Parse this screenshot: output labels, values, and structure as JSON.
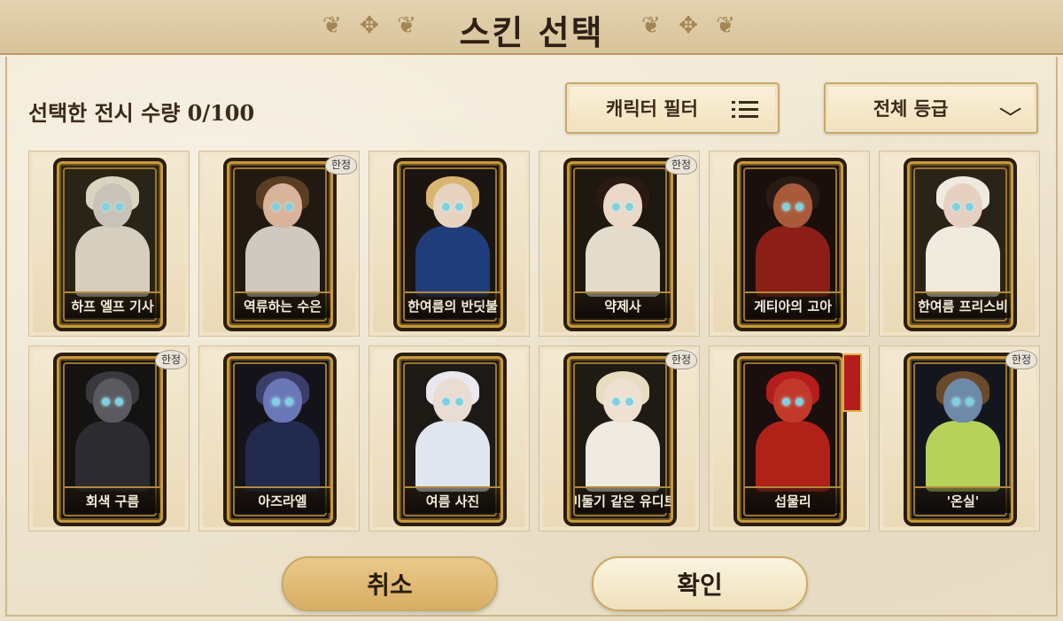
{
  "title": "스킨 선택",
  "selection": {
    "count_label": "선택한 전시 수량 0/100"
  },
  "filters": {
    "character": {
      "label": "캐릭터 필터",
      "icon": "list-icon"
    },
    "grade": {
      "label": "전체 등급",
      "icon": "chevron-down-icon"
    }
  },
  "limited_badge": "한정",
  "skins": [
    {
      "name": "하프 엘프 기사",
      "limited": false,
      "stamp": false,
      "palette": {
        "hair": "#d9d3c0",
        "skin": "#c9c2b8",
        "body": "#d6cfbf",
        "bg": "#2a2416"
      }
    },
    {
      "name": "역류하는 수은",
      "limited": true,
      "stamp": false,
      "palette": {
        "hair": "#5a3d22",
        "skin": "#d9b39a",
        "body": "#cfc9c0",
        "bg": "#221a10"
      }
    },
    {
      "name": "한여름의 반딧불",
      "limited": false,
      "stamp": false,
      "palette": {
        "hair": "#d8b571",
        "skin": "#e8d3c0",
        "body": "#1f3d7a",
        "bg": "#1a1510"
      }
    },
    {
      "name": "약제사",
      "limited": true,
      "stamp": false,
      "palette": {
        "hair": "#2c1a12",
        "skin": "#ecd8c6",
        "body": "#e3dccd",
        "bg": "#1d1810"
      }
    },
    {
      "name": "게티아의 고아",
      "limited": false,
      "stamp": false,
      "palette": {
        "hair": "#2a1a14",
        "skin": "#a85a3a",
        "body": "#8c1e18",
        "bg": "#1a0f0a"
      }
    },
    {
      "name": "한여름 프리스비",
      "limited": false,
      "stamp": false,
      "palette": {
        "hair": "#efeae0",
        "skin": "#e6d0c0",
        "body": "#f0eadf",
        "bg": "#2a2418"
      }
    },
    {
      "name": "회색 구름",
      "limited": true,
      "stamp": false,
      "palette": {
        "hair": "#3a3a3e",
        "skin": "#5a5a60",
        "body": "#2c2c30",
        "bg": "#151311"
      }
    },
    {
      "name": "아즈라엘",
      "limited": false,
      "stamp": false,
      "palette": {
        "hair": "#3a3f6a",
        "skin": "#6a78b8",
        "body": "#222a4e",
        "bg": "#15131a"
      }
    },
    {
      "name": "여름 사진",
      "limited": false,
      "stamp": false,
      "palette": {
        "hair": "#e8e8ee",
        "skin": "#e9dcd2",
        "body": "#dfe6ef",
        "bg": "#1d1a16"
      }
    },
    {
      "name": "비둘기 같은 유디트",
      "limited": true,
      "stamp": false,
      "palette": {
        "hair": "#e8dcc0",
        "skin": "#efe0d2",
        "body": "#efe9df",
        "bg": "#1e1a14"
      }
    },
    {
      "name": "섭물리",
      "limited": false,
      "stamp": true,
      "palette": {
        "hair": "#b51c1c",
        "skin": "#c2392c",
        "body": "#b02218",
        "bg": "#1a0f0c"
      }
    },
    {
      "name": "'온실'",
      "limited": true,
      "stamp": false,
      "palette": {
        "hair": "#6a4a2a",
        "skin": "#6d8aa8",
        "body": "#b6d25a",
        "bg": "#14161e"
      }
    }
  ],
  "buttons": {
    "cancel": "취소",
    "confirm": "확인"
  }
}
